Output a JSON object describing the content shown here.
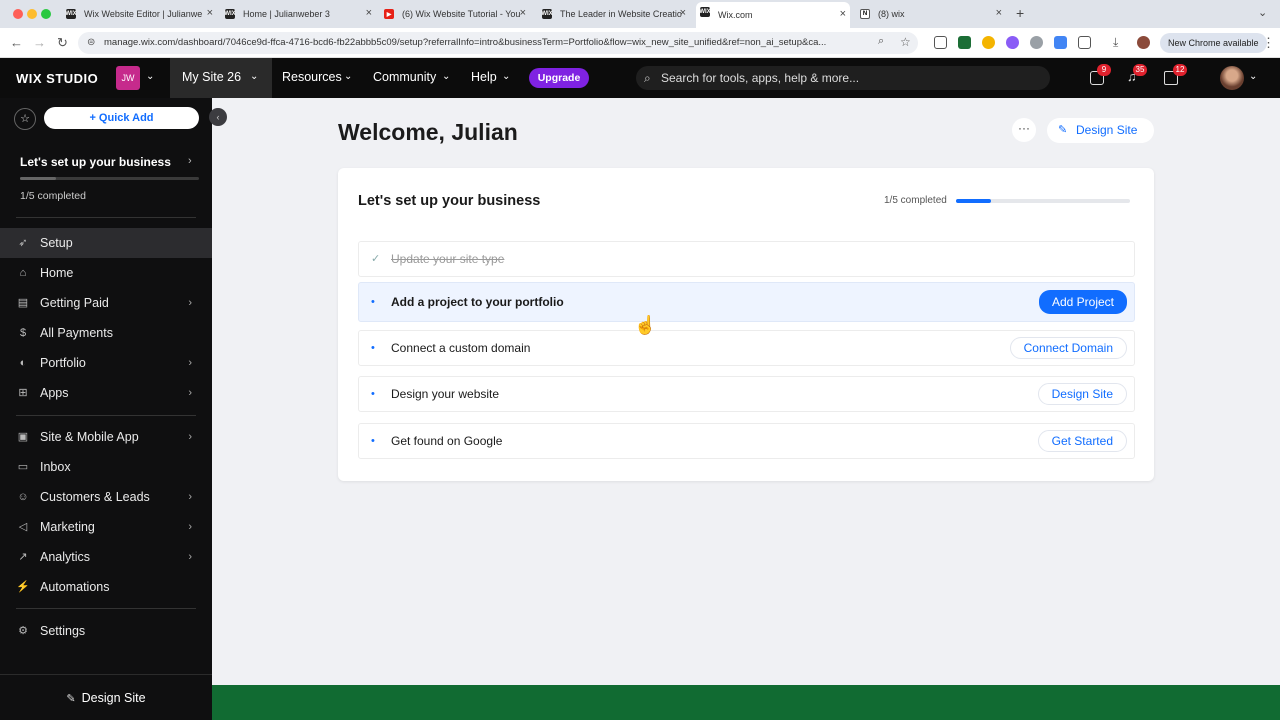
{
  "browser": {
    "tabs": [
      {
        "title": "Wix Website Editor | Julianwe",
        "favicon": "WIX"
      },
      {
        "title": "Home | Julianweber 3",
        "favicon": "WIX"
      },
      {
        "title": "(6) Wix Website Tutorial - You",
        "favicon": "▶"
      },
      {
        "title": "The Leader in Website Creatio",
        "favicon": "WIX"
      },
      {
        "title": "Wix.com",
        "favicon": "WIX"
      },
      {
        "title": "(8) wix",
        "favicon": "N"
      }
    ],
    "url": "manage.wix.com/dashboard/7046ce9d-ffca-4716-bcd6-fb22abbb5c09/setup?referralInfo=intro&businessTerm=Portfolio&flow=wix_new_site_unified&ref=non_ai_setup&ca...",
    "chrome_available": "New Chrome available"
  },
  "topbar": {
    "logo": "WIX STUDIO",
    "workspace_initials": "JW",
    "site_name": "My Site 26",
    "menu": [
      "Resources",
      "Community",
      "Help"
    ],
    "upgrade": "Upgrade",
    "search_placeholder": "Search for tools, apps, help & more...",
    "badges": {
      "chat": "9",
      "notifications": "35",
      "updates": "12"
    }
  },
  "sidebar": {
    "quick_add": "+ Quick Add",
    "setup_title": "Let's set up your business",
    "setup_status": "1/5 completed",
    "setup_progress": 0.2,
    "items": [
      {
        "label": "Setup",
        "icon": "rocket-icon",
        "active": true
      },
      {
        "label": "Home",
        "icon": "home-icon"
      },
      {
        "label": "Getting Paid",
        "icon": "receipt-icon",
        "chevron": true
      },
      {
        "label": "All Payments",
        "icon": "dollar-icon"
      },
      {
        "label": "Portfolio",
        "icon": "portfolio-icon",
        "chevron": true
      },
      {
        "label": "Apps",
        "icon": "apps-icon",
        "chevron": true
      },
      {
        "label": "Site & Mobile App",
        "icon": "site-icon",
        "chevron": true
      },
      {
        "label": "Inbox",
        "icon": "inbox-icon"
      },
      {
        "label": "Customers & Leads",
        "icon": "people-icon",
        "chevron": true
      },
      {
        "label": "Marketing",
        "icon": "megaphone-icon",
        "chevron": true
      },
      {
        "label": "Analytics",
        "icon": "chart-icon",
        "chevron": true
      },
      {
        "label": "Automations",
        "icon": "automation-icon"
      },
      {
        "label": "Settings",
        "icon": "gear-icon"
      }
    ],
    "design_site": "Design Site"
  },
  "main": {
    "welcome": "Welcome, Julian",
    "design_site": "Design Site",
    "card": {
      "title": "Let's set up your business",
      "progress_text": "1/5 completed",
      "progress": 0.2,
      "tasks": [
        {
          "label": "Update your site type",
          "done": true,
          "action": ""
        },
        {
          "label": "Add a project to your portfolio",
          "done": false,
          "action": "Add Project"
        },
        {
          "label": "Connect a custom domain",
          "done": false,
          "action": "Connect Domain"
        },
        {
          "label": "Design your website",
          "done": false,
          "action": "Design Site"
        },
        {
          "label": "Get found on Google",
          "done": false,
          "action": "Get Started"
        }
      ]
    }
  }
}
